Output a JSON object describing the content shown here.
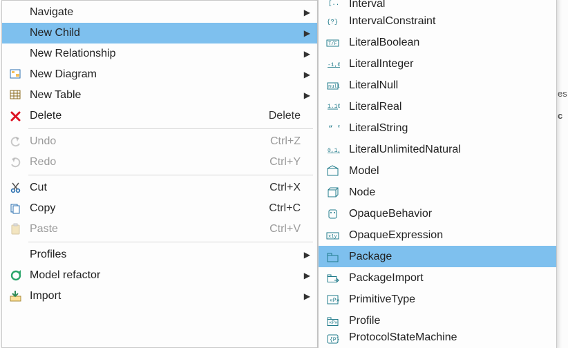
{
  "colors": {
    "highlight": "#7ec0ee",
    "disabled": "#9a9a9a",
    "border": "#c8c8c8"
  },
  "bg_hints": [
    "es",
    "c"
  ],
  "main_menu": {
    "items": [
      {
        "icon": "blank",
        "label": "Navigate",
        "shortcut": "",
        "submenu": true,
        "enabled": true,
        "highlight": false
      },
      {
        "icon": "blank",
        "label": "New Child",
        "shortcut": "",
        "submenu": true,
        "enabled": true,
        "highlight": true
      },
      {
        "icon": "blank",
        "label": "New Relationship",
        "shortcut": "",
        "submenu": true,
        "enabled": true,
        "highlight": false
      },
      {
        "icon": "new-diagram",
        "label": "New Diagram",
        "shortcut": "",
        "submenu": true,
        "enabled": true,
        "highlight": false
      },
      {
        "icon": "new-table",
        "label": "New Table",
        "shortcut": "",
        "submenu": true,
        "enabled": true,
        "highlight": false
      },
      {
        "icon": "delete",
        "label": "Delete",
        "shortcut": "Delete",
        "submenu": false,
        "enabled": true,
        "highlight": false
      },
      {
        "separator": true
      },
      {
        "icon": "undo",
        "label": "Undo",
        "shortcut": "Ctrl+Z",
        "submenu": false,
        "enabled": false,
        "highlight": false
      },
      {
        "icon": "redo",
        "label": "Redo",
        "shortcut": "Ctrl+Y",
        "submenu": false,
        "enabled": false,
        "highlight": false
      },
      {
        "separator": true
      },
      {
        "icon": "cut",
        "label": "Cut",
        "shortcut": "Ctrl+X",
        "submenu": false,
        "enabled": true,
        "highlight": false
      },
      {
        "icon": "copy",
        "label": "Copy",
        "shortcut": "Ctrl+C",
        "submenu": false,
        "enabled": true,
        "highlight": false
      },
      {
        "icon": "paste",
        "label": "Paste",
        "shortcut": "Ctrl+V",
        "submenu": false,
        "enabled": false,
        "highlight": false
      },
      {
        "separator": true
      },
      {
        "icon": "blank",
        "label": "Profiles",
        "shortcut": "",
        "submenu": true,
        "enabled": true,
        "highlight": false
      },
      {
        "icon": "model-refactor",
        "label": "Model refactor",
        "shortcut": "",
        "submenu": true,
        "enabled": true,
        "highlight": false
      },
      {
        "icon": "import",
        "label": "Import",
        "shortcut": "",
        "submenu": true,
        "enabled": true,
        "highlight": false
      }
    ]
  },
  "submenu": {
    "items": [
      {
        "icon": "interval",
        "label": "Interval",
        "cut_top": true
      },
      {
        "icon": "interval-constraint",
        "label": "IntervalConstraint"
      },
      {
        "icon": "literal-boolean",
        "label": "LiteralBoolean"
      },
      {
        "icon": "literal-integer",
        "label": "LiteralInteger"
      },
      {
        "icon": "literal-null",
        "label": "LiteralNull"
      },
      {
        "icon": "literal-real",
        "label": "LiteralReal"
      },
      {
        "icon": "literal-string",
        "label": "LiteralString"
      },
      {
        "icon": "literal-unlimited",
        "label": "LiteralUnlimitedNatural"
      },
      {
        "icon": "model",
        "label": "Model"
      },
      {
        "icon": "node",
        "label": "Node"
      },
      {
        "icon": "opaque-behavior",
        "label": "OpaqueBehavior"
      },
      {
        "icon": "opaque-expression",
        "label": "OpaqueExpression"
      },
      {
        "icon": "package",
        "label": "Package",
        "highlight": true
      },
      {
        "icon": "package-import",
        "label": "PackageImport"
      },
      {
        "icon": "primitive-type",
        "label": "PrimitiveType"
      },
      {
        "icon": "profile",
        "label": "Profile"
      },
      {
        "icon": "protocol-sm",
        "label": "ProtocolStateMachine",
        "cut_bottom": true
      }
    ]
  }
}
